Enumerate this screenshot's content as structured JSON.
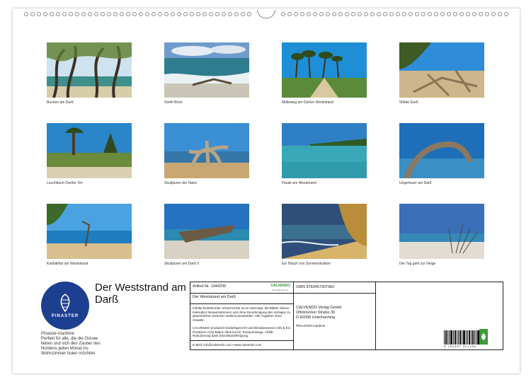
{
  "captions": [
    "Buchen am Darß",
    "Steife Brise",
    "Mülleweg am Darßer Weststrand",
    "Wilder Darß",
    "Leuchtturm Darßer Ort",
    "Skulpturen der Natur",
    "Flaute am Weststrand",
    "Ungeheuer am Darß",
    "Karibikflair am Weststrand",
    "Skulpturen am Darß II",
    "Ein Hauch von Sonnenstrahlen",
    "Der Tag geht zur Neige"
  ],
  "logo": {
    "text": "PINASTER"
  },
  "sidebar": {
    "name": "Pinaster-maritime",
    "description": "Perfekt für alle, die die Ostsee lieben und sich den Zauber des Nordens jeden Monat ins Wohnzimmer holen möchten."
  },
  "title": "Der Weststrand am Darß",
  "imprint": {
    "article": "Artikel-Nr. 1944299",
    "calvendo": "CALVENDO",
    "calvendo_sub": "Der Kalender ist …",
    "calendar_title": "Der Weststrand am Darß",
    "rights": "Inhalte bestehender Schutzrechte ist es untersagt, die Blätter dieses Kalenders herauszutrennen und ohne Genehmigung des Verlages zu gewerblichen Zwecken weiterzuverwenden. Alle Angaben ohne Gewähr.",
    "eco": "CALVENDO produziert bedarfsgerecht und klimabewusst in DE & EU. Positivere CO2-Bilanz dank kurzer Transportwege. Abfall-Reduzierung dank Einzelstückfertigung.",
    "email": "E-Mail: info@calvendo.com • www.calvendo.com",
    "isbn": "ISBN 9783457307960",
    "publisher": [
      "CALVENDO Verlag GmbH",
      "Ottobrunner Straße 39",
      "D-82008 Unterhaching"
    ],
    "author": "PINASTER-maritime",
    "barcode_number": "9 783457 307960"
  }
}
